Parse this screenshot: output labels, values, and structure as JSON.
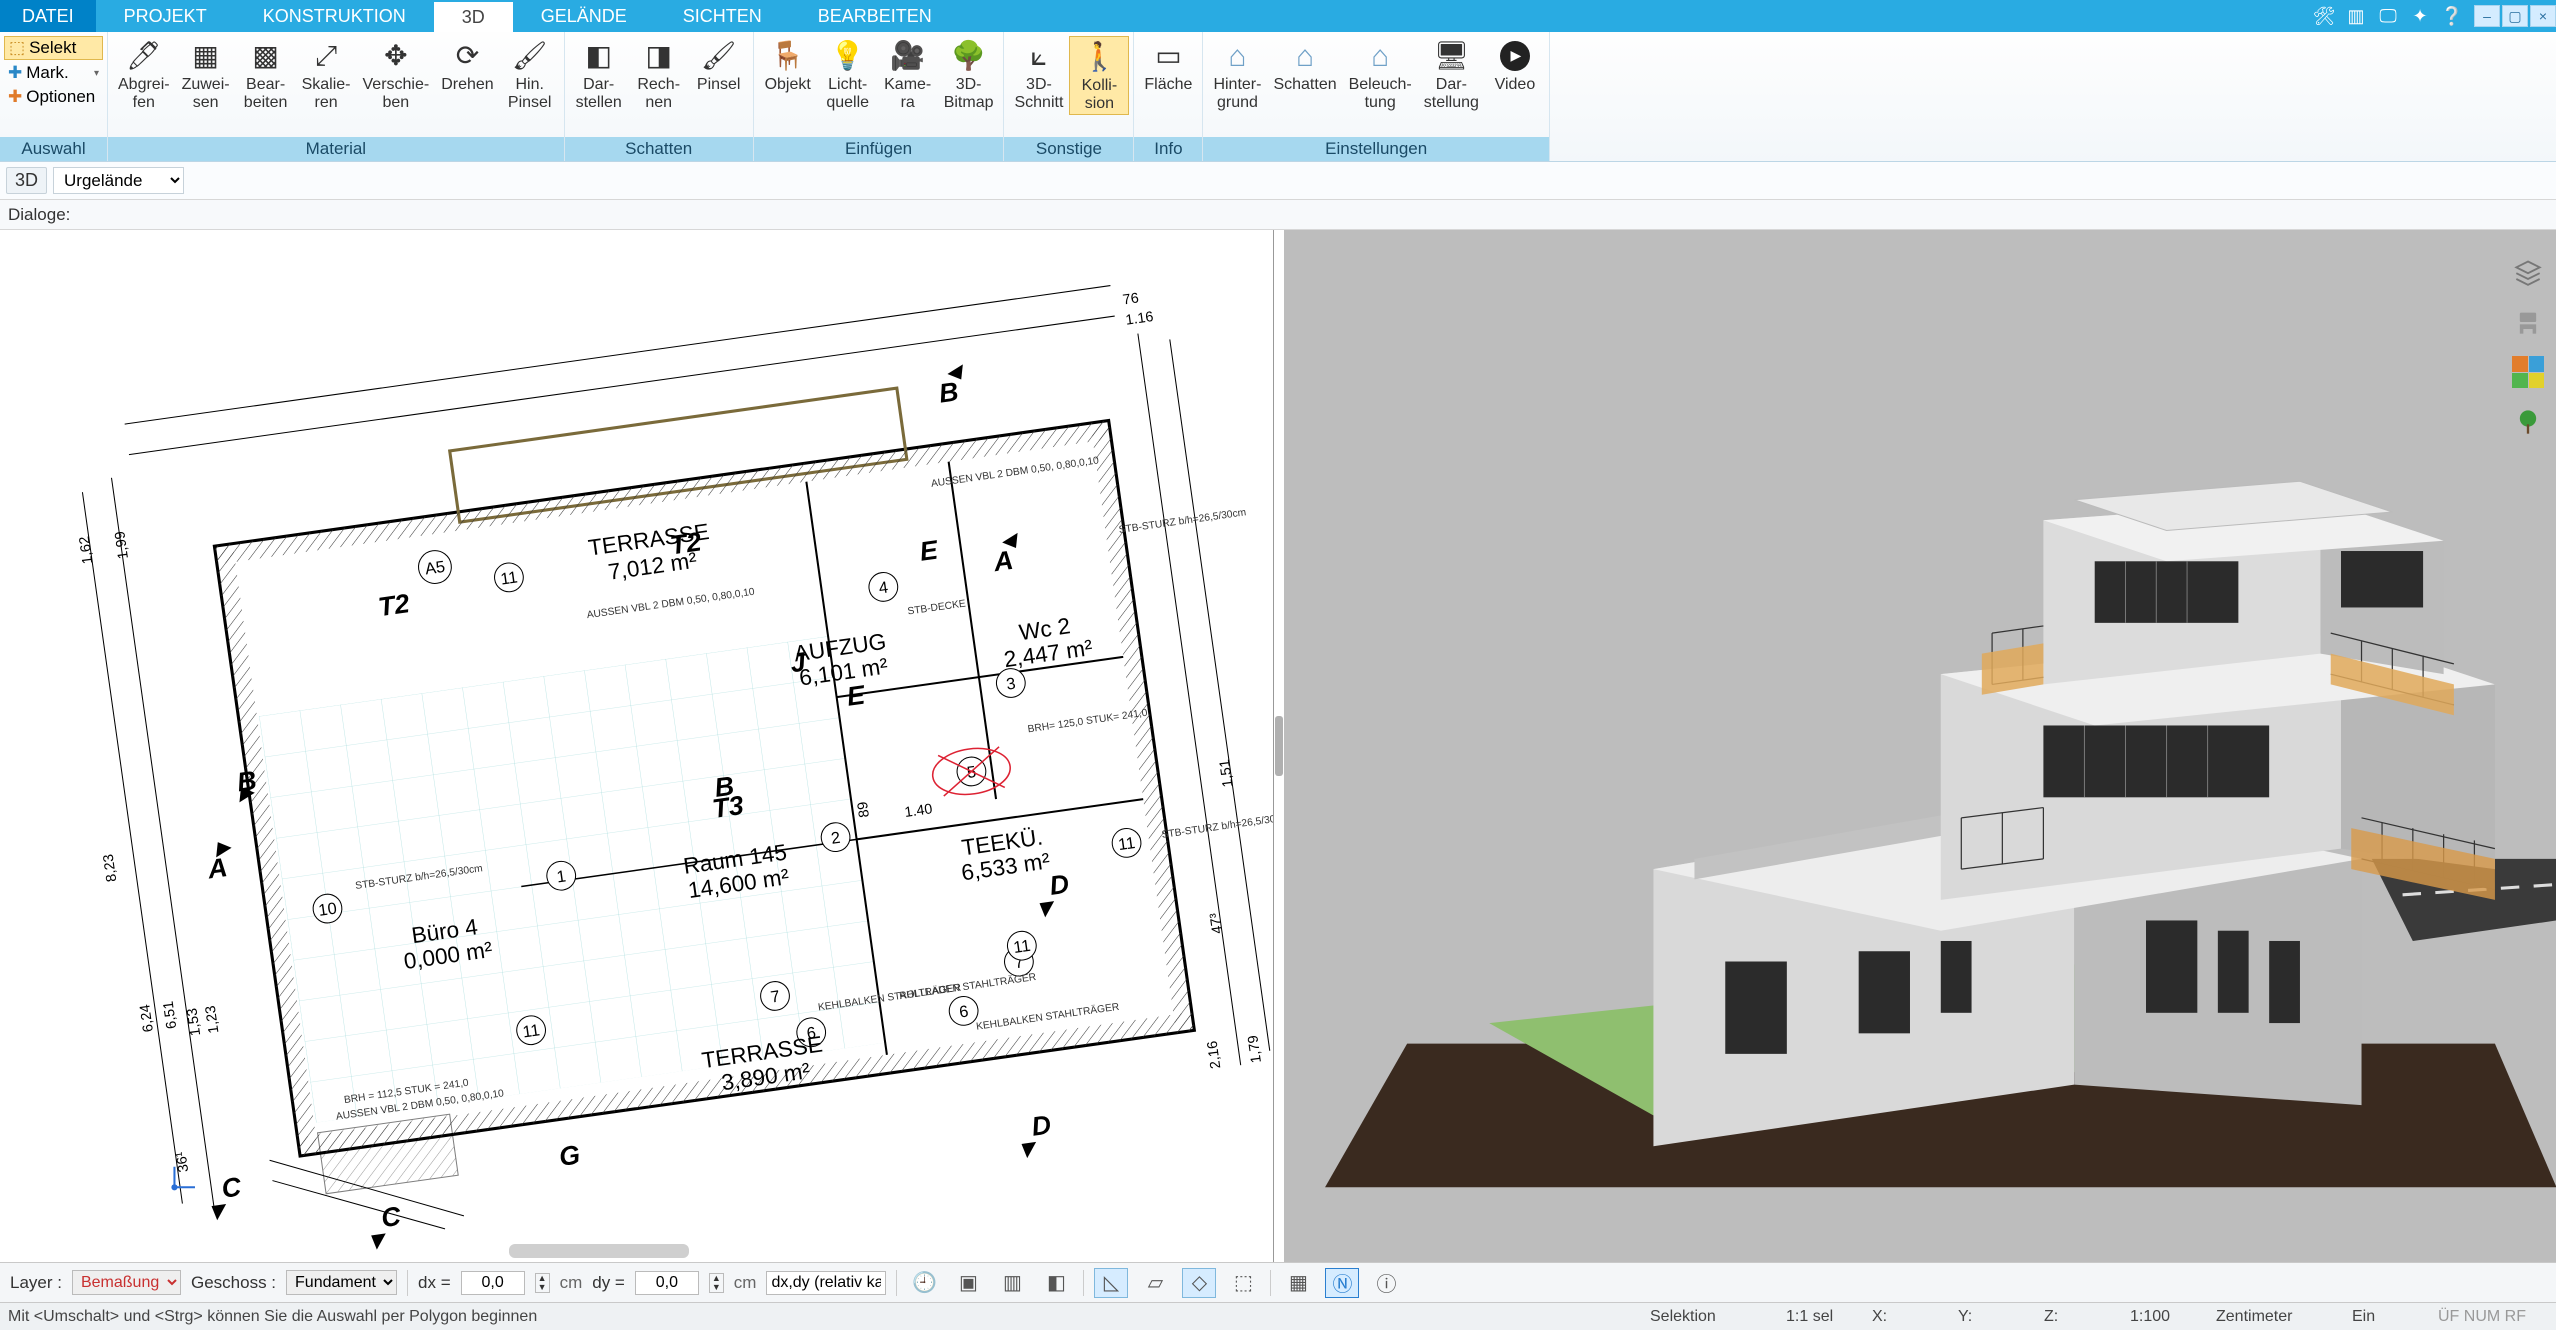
{
  "menu": {
    "tabs": [
      "DATEI",
      "PROJEKT",
      "KONSTRUKTION",
      "3D",
      "GELÄNDE",
      "SICHTEN",
      "BEARBEITEN"
    ],
    "active_index": 3
  },
  "title_icons": [
    "tools-icon",
    "layers-icon",
    "screen-icon",
    "new-icon",
    "help-icon"
  ],
  "selgroup": {
    "selekt": "Selekt",
    "mark": "Mark.",
    "optionen": "Optionen",
    "caption": "Auswahl"
  },
  "ribbon_groups": [
    {
      "caption": "Material",
      "buttons": [
        {
          "id": "abgreifen",
          "label": "Abgrei-\nfen"
        },
        {
          "id": "zuweisen",
          "label": "Zuwei-\nsen"
        },
        {
          "id": "bearbeiten",
          "label": "Bear-\nbeiten"
        },
        {
          "id": "skalieren",
          "label": "Skalie-\nren"
        },
        {
          "id": "verschieben",
          "label": "Verschie-\nben"
        },
        {
          "id": "drehen",
          "label": "Drehen"
        },
        {
          "id": "hinpinsel",
          "label": "Hin.\nPinsel"
        }
      ]
    },
    {
      "caption": "Schatten",
      "buttons": [
        {
          "id": "darstellen",
          "label": "Dar-\nstellen"
        },
        {
          "id": "rechnen",
          "label": "Rech-\nnen"
        },
        {
          "id": "pinsel",
          "label": "Pinsel"
        }
      ]
    },
    {
      "caption": "Einfügen",
      "buttons": [
        {
          "id": "objekt",
          "label": "Objekt"
        },
        {
          "id": "lichtquelle",
          "label": "Licht-\nquelle"
        },
        {
          "id": "kamera",
          "label": "Kame-\nra"
        },
        {
          "id": "bitmap3d",
          "label": "3D-\nBitmap"
        }
      ]
    },
    {
      "caption": "Sonstige",
      "buttons": [
        {
          "id": "schnitt3d",
          "label": "3D-\nSchnitt"
        },
        {
          "id": "kollision",
          "label": "Kolli-\nsion",
          "active": true
        }
      ]
    },
    {
      "caption": "Info",
      "buttons": [
        {
          "id": "flaeche",
          "label": "Fläche"
        }
      ]
    },
    {
      "caption": "Einstellungen",
      "buttons": [
        {
          "id": "hintergrund",
          "label": "Hinter-\ngrund"
        },
        {
          "id": "schatten2",
          "label": "Schatten"
        },
        {
          "id": "beleuchtung",
          "label": "Beleuch-\ntung"
        },
        {
          "id": "darstellung",
          "label": "Dar-\nstellung"
        },
        {
          "id": "video",
          "label": "Video"
        }
      ]
    }
  ],
  "secbar": {
    "view_mode": "3D",
    "terrain_select": "Urgelände"
  },
  "dlgbar": {
    "label": "Dialoge:"
  },
  "floorplan_rooms": [
    {
      "name": "TERRASSE",
      "area": "7,012 m²"
    },
    {
      "name": "AUFZUG",
      "area": "6,101 m²"
    },
    {
      "name": "Wc 2",
      "area": "2,447 m²"
    },
    {
      "name": "Büro 4",
      "area": "0,000 m²"
    },
    {
      "name": "Raum 145",
      "area": "14,600 m²"
    },
    {
      "name": "TEEKÜ.",
      "area": "6,533 m²"
    },
    {
      "name": "TERRASSE",
      "area": "3,890 m²"
    }
  ],
  "floorplan_dims": [
    "76",
    "1.16",
    "1,62",
    "1,99",
    "8,23",
    "6,24",
    "6,51",
    "1,53",
    "1,23",
    "36¹",
    "1,51",
    "2,16",
    "1,79",
    "47³",
    "1.40",
    "89"
  ],
  "floorplan_notes": [
    "STB-STURZ b/h=26,5/30cm",
    "AUSSEN VBL 2 DBM 0,50, 0,80,0,10",
    "STB-DECKE",
    "ROLLLADEN STAHLTRÄGER",
    "KEHLBALKEN STAHLTRÄGER",
    "BRH = 112,5 STUK = 241,0",
    "BRH= 125,0 STUK= 241,0"
  ],
  "floorplan_markers": [
    "A",
    "B",
    "C",
    "D",
    "E",
    "G",
    "J",
    "A5",
    "T2",
    "T3",
    "1",
    "2",
    "3",
    "4",
    "5",
    "6",
    "7",
    "10",
    "11"
  ],
  "bottom": {
    "layer_label": "Layer :",
    "layer_value": "Bemaßung",
    "geschoss_label": "Geschoss :",
    "geschoss_value": "Fundament",
    "dx_label": "dx =",
    "dx_value": "0,0",
    "dy_label": "dy =",
    "dy_value": "0,0",
    "unit": "cm",
    "mode_text": "dx,dy (relativ ka"
  },
  "status": {
    "hint": "Mit <Umschalt> und <Strg> können Sie die Auswahl per Polygon beginnen",
    "selektion": "Selektion",
    "sel": "1:1 sel",
    "x": "X:",
    "y": "Y:",
    "z": "Z:",
    "scale": "1:100",
    "units": "Zentimeter",
    "ein": "Ein",
    "caps": "ÜF NUM RF"
  },
  "sidetools": [
    "layers-icon",
    "furniture-icon",
    "palette-icon",
    "tree-icon"
  ]
}
